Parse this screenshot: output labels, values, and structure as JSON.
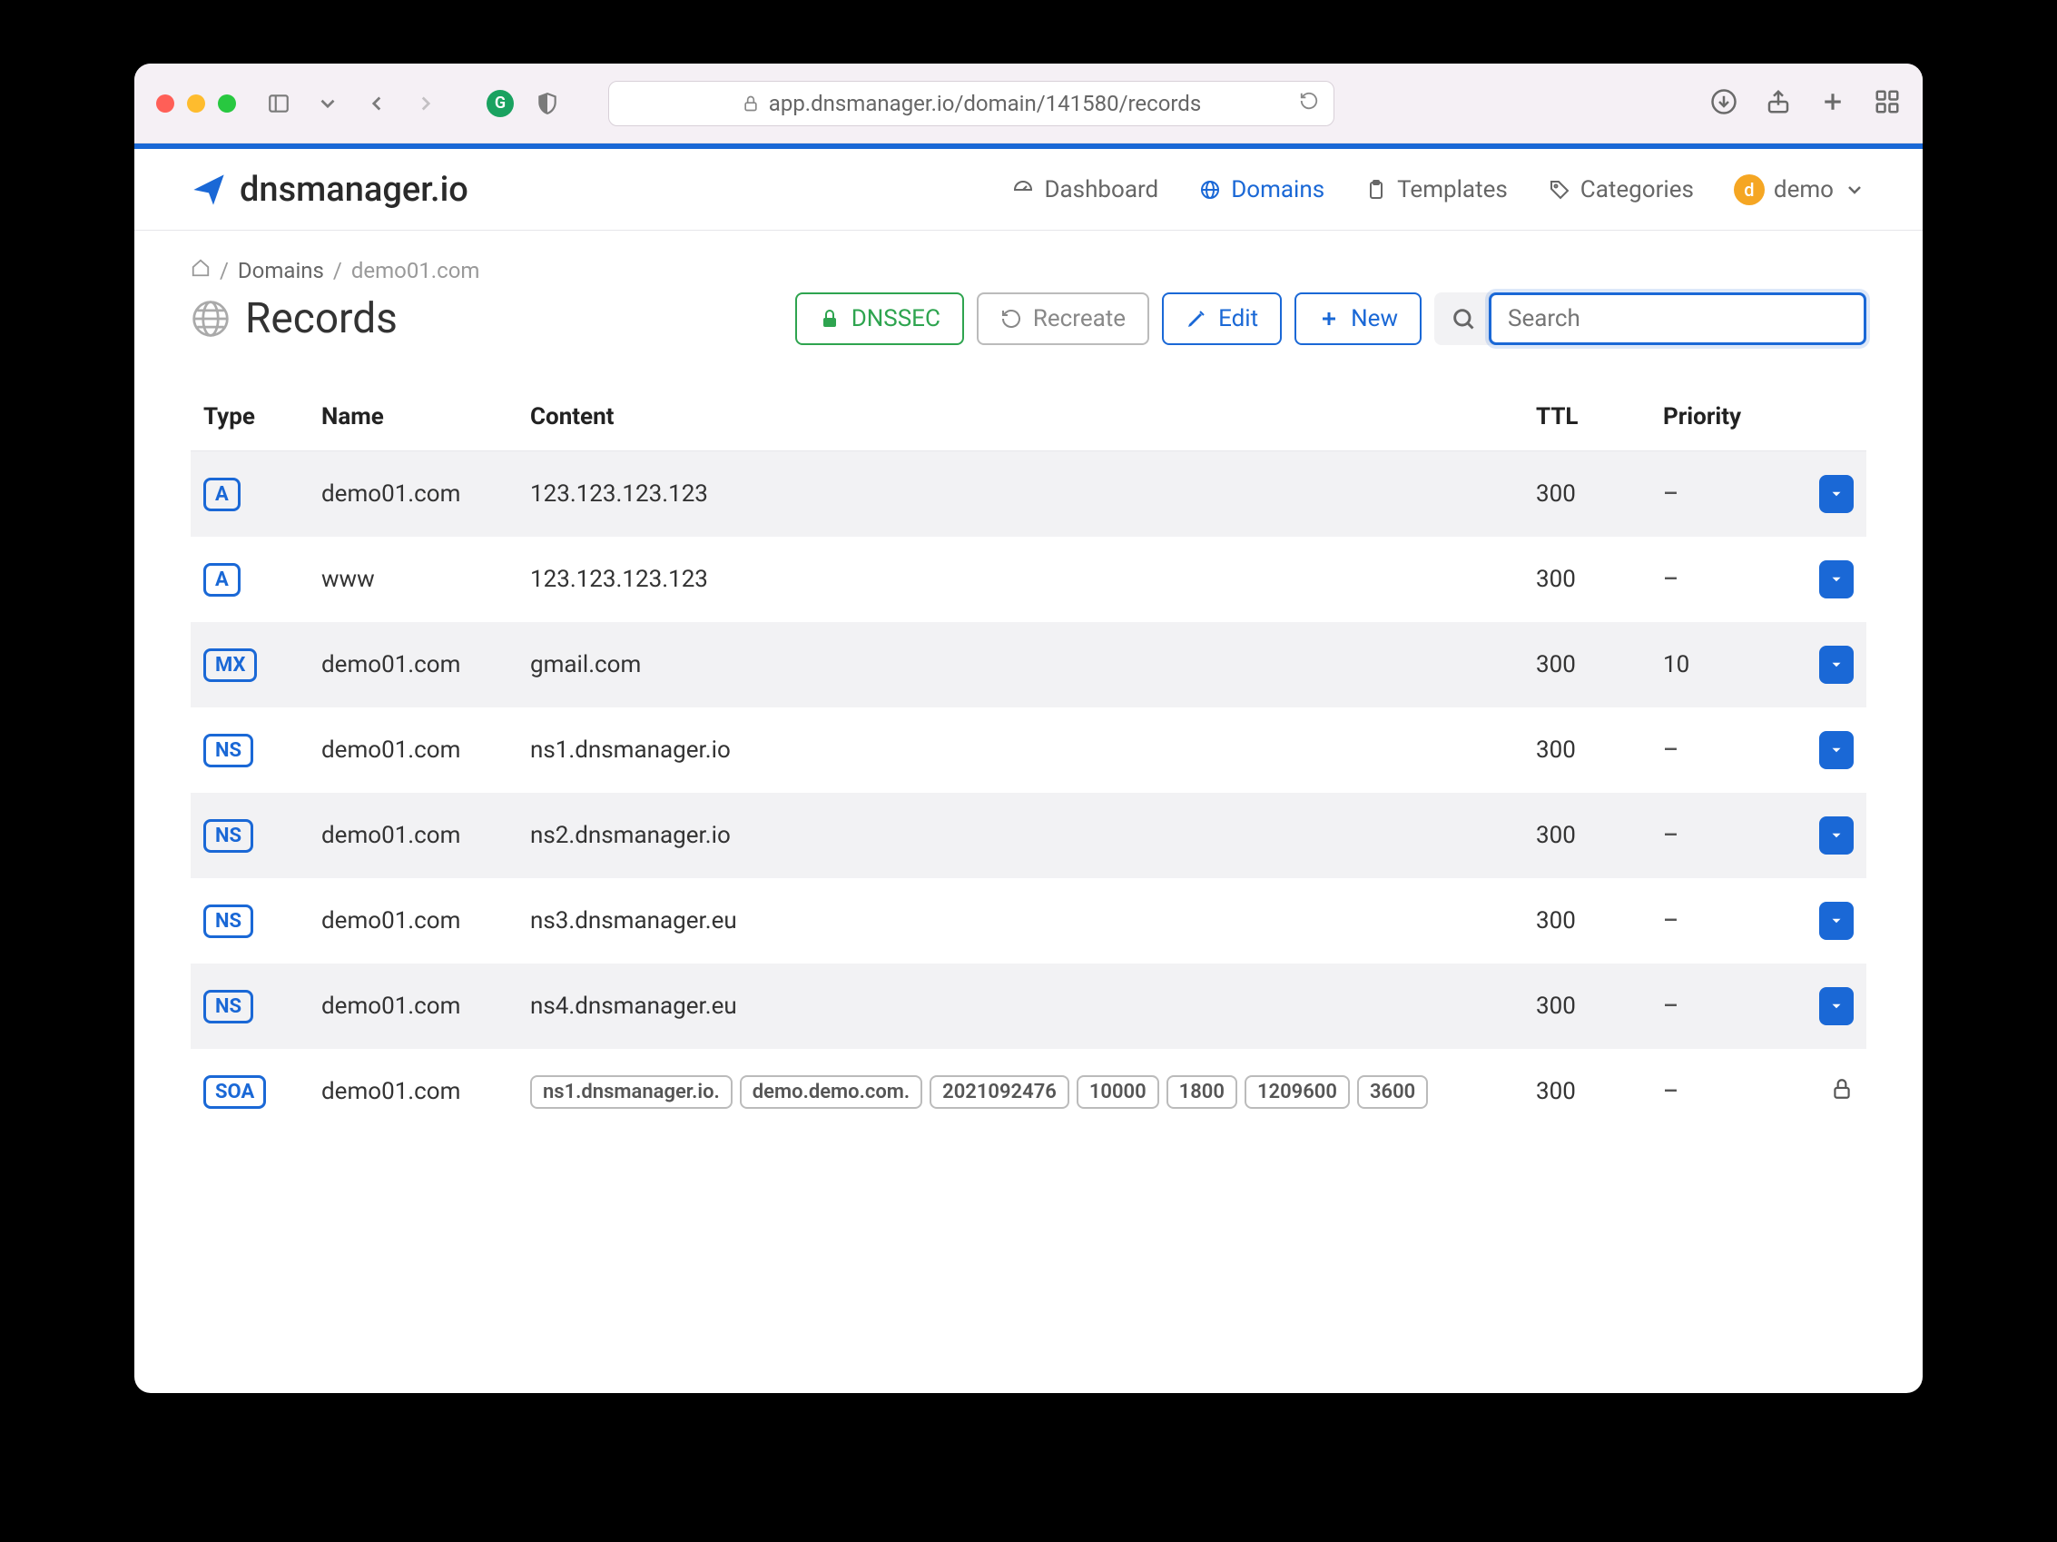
{
  "browser": {
    "url": "app.dnsmanager.io/domain/141580/records"
  },
  "brand": "dnsmanager.io",
  "nav": {
    "dashboard": "Dashboard",
    "domains": "Domains",
    "templates": "Templates",
    "categories": "Categories",
    "user": "demo",
    "user_initial": "d"
  },
  "breadcrumb": {
    "domains": "Domains",
    "current": "demo01.com"
  },
  "page": {
    "title": "Records"
  },
  "actions": {
    "dnssec": "DNSSEC",
    "recreate": "Recreate",
    "edit": "Edit",
    "new": "New"
  },
  "search": {
    "placeholder": "Search"
  },
  "table": {
    "headers": {
      "type": "Type",
      "name": "Name",
      "content": "Content",
      "ttl": "TTL",
      "priority": "Priority"
    },
    "rows": [
      {
        "type": "A",
        "name": "demo01.com",
        "content": "123.123.123.123",
        "ttl": "300",
        "priority": "–",
        "locked": false
      },
      {
        "type": "A",
        "name": "www",
        "content": "123.123.123.123",
        "ttl": "300",
        "priority": "–",
        "locked": false
      },
      {
        "type": "MX",
        "name": "demo01.com",
        "content": "gmail.com",
        "ttl": "300",
        "priority": "10",
        "locked": false
      },
      {
        "type": "NS",
        "name": "demo01.com",
        "content": "ns1.dnsmanager.io",
        "ttl": "300",
        "priority": "–",
        "locked": false
      },
      {
        "type": "NS",
        "name": "demo01.com",
        "content": "ns2.dnsmanager.io",
        "ttl": "300",
        "priority": "–",
        "locked": false
      },
      {
        "type": "NS",
        "name": "demo01.com",
        "content": "ns3.dnsmanager.eu",
        "ttl": "300",
        "priority": "–",
        "locked": false
      },
      {
        "type": "NS",
        "name": "demo01.com",
        "content": "ns4.dnsmanager.eu",
        "ttl": "300",
        "priority": "–",
        "locked": false
      },
      {
        "type": "SOA",
        "name": "demo01.com",
        "soa": [
          "ns1.dnsmanager.io.",
          "demo.demo.com.",
          "2021092476",
          "10000",
          "1800",
          "1209600",
          "3600"
        ],
        "ttl": "300",
        "priority": "–",
        "locked": true
      }
    ]
  }
}
